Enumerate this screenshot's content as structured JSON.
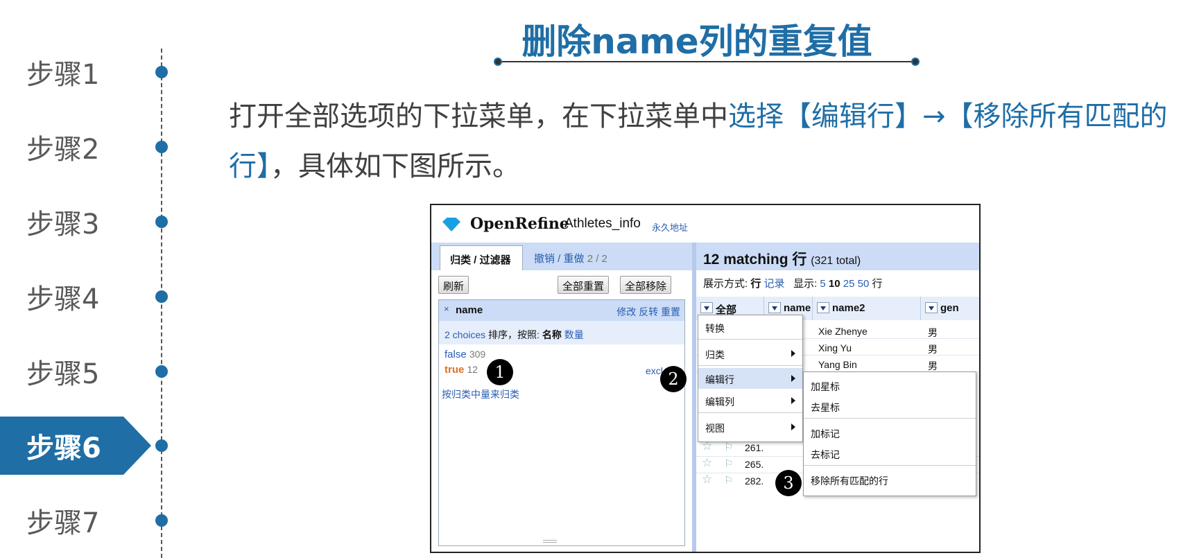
{
  "steps": [
    {
      "label": "步骤1"
    },
    {
      "label": "步骤2"
    },
    {
      "label": "步骤3"
    },
    {
      "label": "步骤4"
    },
    {
      "label": "步骤5"
    },
    {
      "label": "步骤6",
      "active": true
    },
    {
      "label": "步骤7"
    }
  ],
  "header": {
    "title": "删除name列的重复值"
  },
  "description": {
    "part1": "打开全部选项的下拉菜单，在下拉菜单中",
    "highlight1": "选择【编辑行】→【移除所有匹配的行】",
    "part2": "，具体如下图所示。"
  },
  "screenshot": {
    "brand": "OpenRefine",
    "project": "Athletes_info",
    "permalink": "永久地址",
    "left_panel": {
      "tab_facets": "归类 / 过滤器",
      "tab_undo": "撤销 / 重做",
      "undo_count": "2 / 2",
      "refresh": "刷新",
      "reset_all": "全部重置",
      "remove_all": "全部移除",
      "facet": {
        "close": "×",
        "name": "name",
        "edit": "修改",
        "invert": "反转",
        "reset": "重置",
        "choices": "2 choices",
        "sort_by": "排序，按照:",
        "sort_name": "名称",
        "sort_count": "数量",
        "items": [
          {
            "label": "false",
            "count": "309"
          },
          {
            "label": "true",
            "count": "12"
          }
        ],
        "exclude": "excl",
        "cluster": "按归类中量来归类"
      }
    },
    "right_panel": {
      "matching": "12 matching 行",
      "total": "(321 total)",
      "show_as": "展示方式:",
      "rows_mode": "行",
      "records_mode": "记录",
      "show": "显示:",
      "page_sizes": [
        "5",
        "10",
        "25",
        "50"
      ],
      "rows_unit": "行",
      "columns": [
        "全部",
        "name",
        "name2",
        "gen"
      ],
      "rows": [
        {
          "name2": "Xie Zhenye",
          "gender": "男"
        },
        {
          "name2": "Xing Yu",
          "gender": "男"
        },
        {
          "name2": "Yang Bin",
          "gender": "男"
        }
      ],
      "row_nums": [
        "261.",
        "265.",
        "282."
      ]
    },
    "menu_main": [
      "转换",
      "归类",
      "编辑行",
      "编辑列",
      "视图"
    ],
    "menu_sub": [
      "加星标",
      "去星标",
      "加标记",
      "去标记",
      "移除所有匹配的行"
    ],
    "badges": [
      "1",
      "2",
      "3"
    ]
  },
  "colors": {
    "accent": "#1f6ea6",
    "link": "#2a5db0",
    "true_choice": "#e07020"
  }
}
